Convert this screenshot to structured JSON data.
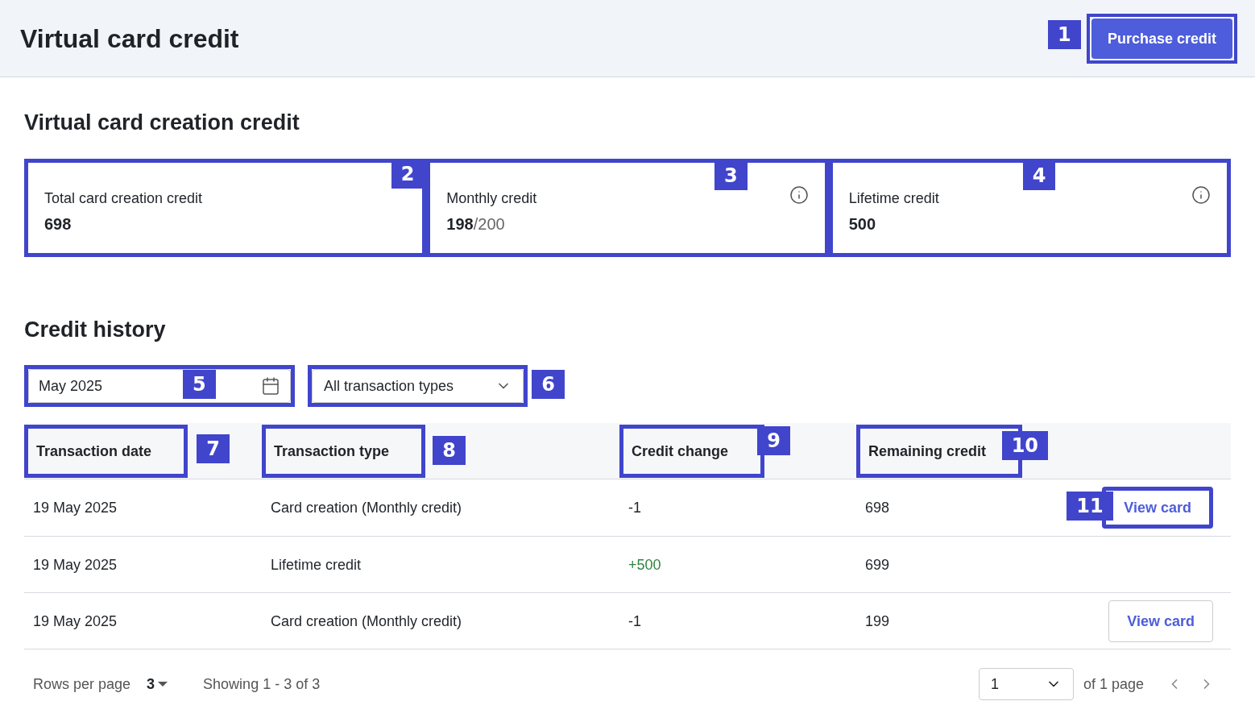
{
  "header": {
    "title": "Virtual card credit",
    "purchase_button": {
      "label": "Purchase credit",
      "callout": "1"
    }
  },
  "credit_section": {
    "title": "Virtual card creation credit",
    "cards": [
      {
        "label": "Total card creation credit",
        "value": "698",
        "callout": "2",
        "info": false
      },
      {
        "label": "Monthly credit",
        "value": "198",
        "total": "/200",
        "callout": "3",
        "info": true
      },
      {
        "label": "Lifetime credit",
        "value": "500",
        "callout": "4",
        "info": true
      }
    ]
  },
  "history": {
    "title": "Credit history",
    "date_filter": {
      "value": "May 2025",
      "callout": "5"
    },
    "type_filter": {
      "value": "All transaction types",
      "callout": "6"
    },
    "columns": [
      {
        "label": "Transaction date",
        "callout": "7"
      },
      {
        "label": "Transaction type",
        "callout": "8"
      },
      {
        "label": "Credit change",
        "callout": "9"
      },
      {
        "label": "Remaining credit",
        "callout": "10"
      }
    ],
    "rows": [
      {
        "date": "19 May 2025",
        "type": "Card creation (Monthly credit)",
        "change": "-1",
        "color": "#1f2328",
        "remaining": "698",
        "action": "View card",
        "action_callout": "11"
      },
      {
        "date": "19 May 2025",
        "type": "Lifetime credit",
        "change": "+500",
        "color": "#2e8540",
        "remaining": "699"
      },
      {
        "date": "19 May 2025",
        "type": "Card creation (Monthly credit)",
        "change": "-1",
        "color": "#1f2328",
        "remaining": "199",
        "action": "View card"
      }
    ]
  },
  "pagination": {
    "rows_per_page_label": "Rows per page",
    "rows_per_page": "3",
    "showing": "Showing 1 - 3 of 3",
    "page": "1",
    "page_of": "of 1 page"
  }
}
